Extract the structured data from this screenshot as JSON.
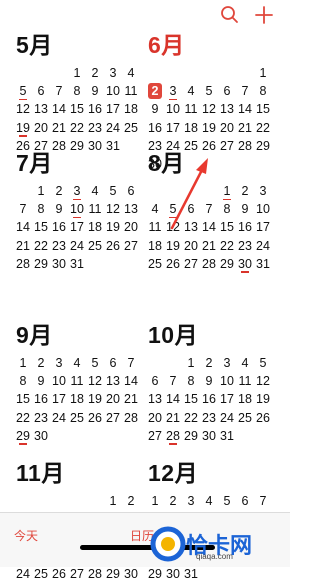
{
  "toolbar": {
    "search_icon": "search-icon",
    "add_icon": "plus-icon",
    "accent_color": "#e0473c"
  },
  "months": [
    {
      "title": "5月",
      "offset": 3,
      "days": 31,
      "events": [
        5,
        19
      ],
      "today": null,
      "title_red": false
    },
    {
      "title": "6月",
      "offset": 6,
      "days": 30,
      "events": [
        3
      ],
      "today": 2,
      "title_red": true
    },
    {
      "title": "7月",
      "offset": 1,
      "days": 31,
      "events": [
        3,
        10
      ],
      "today": null,
      "title_red": false
    },
    {
      "title": "8月",
      "offset": 4,
      "days": 31,
      "events": [
        5,
        1,
        30
      ],
      "today": null,
      "title_red": false
    },
    {
      "title": "9月",
      "offset": 0,
      "days": 30,
      "events": [
        29
      ],
      "today": null,
      "title_red": false
    },
    {
      "title": "10月",
      "offset": 2,
      "days": 31,
      "events": [
        28
      ],
      "today": null,
      "title_red": false
    },
    {
      "title": "11月",
      "offset": 5,
      "days": 30,
      "events": [],
      "today": null,
      "title_red": false
    },
    {
      "title": "12月",
      "offset": 0,
      "days": 31,
      "events": [],
      "today": null,
      "title_red": false
    }
  ],
  "bottom_bar": {
    "today_label": "今天",
    "calendar_label": "日历"
  },
  "watermark": {
    "brand": "恰卡网",
    "url": "qiaqa.com"
  }
}
